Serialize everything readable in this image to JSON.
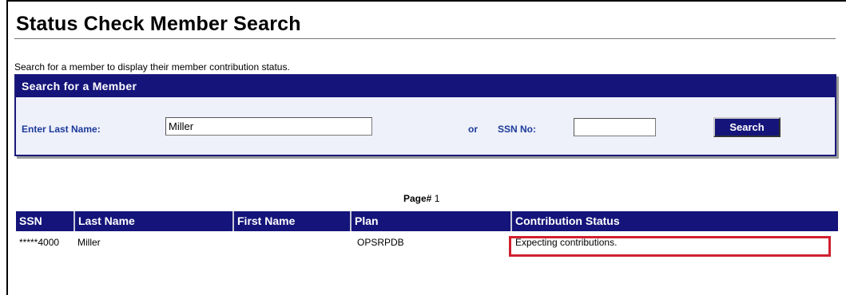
{
  "page": {
    "title": "Status Check Member Search",
    "intro": "Search for a member to display their member contribution status."
  },
  "search": {
    "header": "Search for a Member",
    "last_name_label": "Enter Last Name:",
    "last_name_value": "Miller",
    "or_label": "or",
    "ssn_label": "SSN No:",
    "ssn_value": "",
    "button_label": "Search"
  },
  "pager": {
    "label": "Page#",
    "number": "1"
  },
  "results": {
    "columns": [
      "SSN",
      "Last Name",
      "First Name",
      "Plan",
      "Contribution Status"
    ],
    "rows": [
      {
        "ssn": "*****4000",
        "last_name": "Miller",
        "first_name": "",
        "plan": "OPSRPDB",
        "status": "Expecting contributions."
      }
    ]
  },
  "colors": {
    "header_navy": "#14147a",
    "label_blue": "#1c3a9a",
    "highlight_red": "#d02030"
  }
}
